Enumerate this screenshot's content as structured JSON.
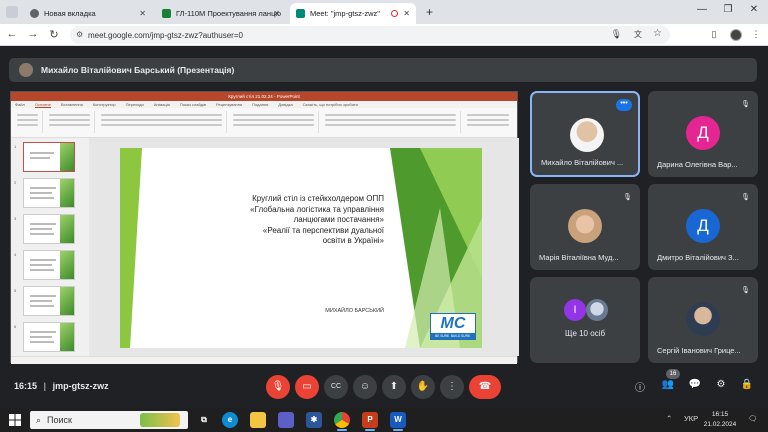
{
  "browser": {
    "tabs": [
      {
        "label": "Новая вкладка",
        "active": false,
        "favicon_color": "#5f6368"
      },
      {
        "label": "ГЛ-110М Проектування ланцю",
        "active": false,
        "favicon_color": "#188038"
      },
      {
        "label": "Meet: \"jmp-gtsz-zwz\"",
        "active": true,
        "favicon_color": "#00897b"
      }
    ],
    "new_tab": "+",
    "url": "meet.google.com/jmp-gtsz-zwz?authuser=0"
  },
  "meet": {
    "presenter_label": "Михайло Віталійович Барський (Презентація)",
    "ppt": {
      "window_title": "Круглий стіл 21.02.24 - PowerPoint",
      "tabs": [
        "Файл",
        "Основне",
        "Вставлення",
        "Конструктор",
        "Переходи",
        "Анімація",
        "Показ слайдів",
        "Рецензування",
        "Подання",
        "Довідка",
        "Скажіть, що потрібно зробити"
      ],
      "slide": {
        "title_lines": [
          "Круглий стіл із стейкхолдером ОПП",
          "«Глобальна логістика та управління",
          "ланцюгами постачання»",
          "«Реалії та перспективи дуальної",
          "освіти в Україні»"
        ],
        "author": "МИХАЙЛО БАРСЬКИЙ",
        "logo_text": "MC",
        "logo_sub": "BE SURE. BUILD SURE."
      }
    },
    "participants": [
      {
        "name": "Михайло Віталійович ...",
        "type": "photo",
        "speaking": true
      },
      {
        "name": "Дарина Олегівна Вар...",
        "type": "avatar",
        "initial": "Д",
        "color": "#e52592",
        "muted": true
      },
      {
        "name": "Марія Віталіївна Муд...",
        "type": "photo",
        "muted": true
      },
      {
        "name": "Дмитро Віталійович З...",
        "type": "avatar",
        "initial": "Д",
        "color": "#1967d2",
        "muted": true
      },
      {
        "name": "Ще 10 осіб",
        "type": "group",
        "initial": "I",
        "color": "#9334e6"
      },
      {
        "name": "Сергій Іванович Грице...",
        "type": "photo",
        "muted": true
      }
    ],
    "time": "16:15",
    "meeting_code": "jmp-gtsz-zwz",
    "participant_count": "16"
  },
  "taskbar": {
    "search_placeholder": "Поиск",
    "lang": "УКР",
    "time": "16:15",
    "date": "21.02.2024"
  }
}
